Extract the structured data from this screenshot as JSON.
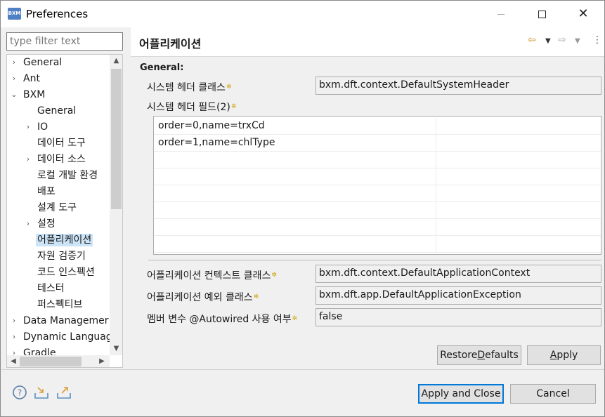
{
  "window": {
    "icon_text": "BXM",
    "title": "Preferences"
  },
  "filter": {
    "placeholder": "type filter text"
  },
  "tree": {
    "items": [
      {
        "label": "General",
        "level": 0,
        "arrow": "›"
      },
      {
        "label": "Ant",
        "level": 0,
        "arrow": "›"
      },
      {
        "label": "BXM",
        "level": 0,
        "arrow": "⌄"
      },
      {
        "label": "General",
        "level": 1,
        "arrow": ""
      },
      {
        "label": "IO",
        "level": 1,
        "arrow": "›"
      },
      {
        "label": "데이터 도구",
        "level": 1,
        "arrow": ""
      },
      {
        "label": "데이터 소스",
        "level": 1,
        "arrow": "›"
      },
      {
        "label": "로컬 개발 환경",
        "level": 1,
        "arrow": ""
      },
      {
        "label": "배포",
        "level": 1,
        "arrow": ""
      },
      {
        "label": "설계 도구",
        "level": 1,
        "arrow": ""
      },
      {
        "label": "설정",
        "level": 1,
        "arrow": "›"
      },
      {
        "label": "어플리케이션",
        "level": 1,
        "arrow": "",
        "selected": true
      },
      {
        "label": "자원 검증기",
        "level": 1,
        "arrow": ""
      },
      {
        "label": "코드 인스펙션",
        "level": 1,
        "arrow": ""
      },
      {
        "label": "테스터",
        "level": 1,
        "arrow": ""
      },
      {
        "label": "퍼스펙티브",
        "level": 1,
        "arrow": ""
      },
      {
        "label": "Data Managemer",
        "level": 0,
        "arrow": "›"
      },
      {
        "label": "Dynamic Languag",
        "level": 0,
        "arrow": "›"
      },
      {
        "label": "Gradle",
        "level": 0,
        "arrow": "›"
      }
    ]
  },
  "page": {
    "title": "어플리케이션",
    "section": "General:",
    "fields": {
      "system_header_class": {
        "label": "시스템 헤더 클래스",
        "value": "bxm.dft.context.DefaultSystemHeader"
      },
      "system_header_field": {
        "label": "시스템 헤더 필드(2)"
      },
      "app_context_class": {
        "label": "어플리케이션 컨텍스트 클래스",
        "value": "bxm.dft.context.DefaultApplicationContext"
      },
      "app_exception_class": {
        "label": "어플리케이션 예외 클래스",
        "value": "bxm.dft.app.DefaultApplicationException"
      },
      "autowired": {
        "label": "멤버 변수 @Autowired 사용 여부",
        "value": "false"
      }
    },
    "header_fields_rows": [
      {
        "c1": "order=0,name=trxCd",
        "c2": ""
      },
      {
        "c1": "order=1,name=chlType",
        "c2": ""
      },
      {
        "c1": "",
        "c2": ""
      },
      {
        "c1": "",
        "c2": ""
      },
      {
        "c1": "",
        "c2": ""
      },
      {
        "c1": "",
        "c2": ""
      },
      {
        "c1": "",
        "c2": ""
      },
      {
        "c1": "",
        "c2": ""
      }
    ],
    "required_marker": "✲"
  },
  "buttons": {
    "restore_defaults_pre": "Restore ",
    "restore_defaults_mn": "D",
    "restore_defaults_post": "efaults",
    "apply_mn": "A",
    "apply_post": "pply",
    "apply_and_close": "Apply and Close",
    "cancel": "Cancel"
  },
  "colors": {
    "selection": "#cce4f7",
    "default_button_border": "#0078d7",
    "required_marker": "#c9a400"
  }
}
